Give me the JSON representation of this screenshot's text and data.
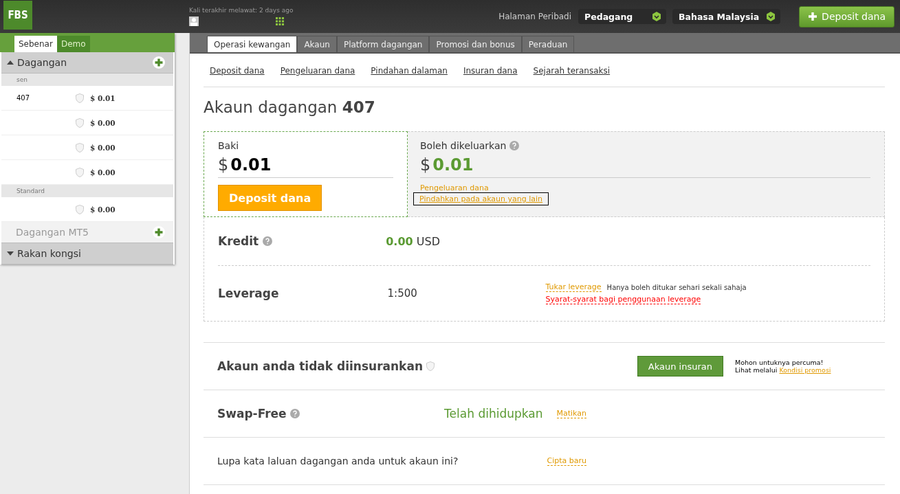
{
  "header": {
    "logo": "FBS",
    "last_visit": "Kali terakhir melawat: 2 days ago",
    "personal_label": "Halaman Peribadi",
    "role_select": "Pedagang",
    "language_select": "Bahasa Malaysia",
    "deposit_button": "Deposit dana"
  },
  "sidebar": {
    "tabs": [
      {
        "label": "Sebenar",
        "selected": true
      },
      {
        "label": "Demo",
        "selected": false
      }
    ],
    "sections": [
      {
        "title": "Dagangan",
        "expanded": true,
        "disabled": false,
        "add": true,
        "groups": [
          {
            "label": "sen",
            "accounts": [
              {
                "number": "407",
                "balance": "0.01",
                "currency": "$"
              },
              {
                "balance": "0.00",
                "currency": "$"
              },
              {
                "balance": "0.00",
                "currency": "$"
              },
              {
                "balance": "0.00",
                "currency": "$"
              }
            ]
          },
          {
            "label": "Standard",
            "accounts": [
              {
                "balance": "0.00",
                "currency": "$"
              }
            ]
          }
        ]
      },
      {
        "title": "Dagangan MT5",
        "expanded": false,
        "disabled": true,
        "add": true
      },
      {
        "title": "Rakan kongsi",
        "expanded": false,
        "disabled": false,
        "add": false
      }
    ]
  },
  "tabs": [
    {
      "label": "Operasi kewangan",
      "selected": true
    },
    {
      "label": "Akaun",
      "selected": false
    },
    {
      "label": "Platform dagangan",
      "selected": false
    },
    {
      "label": "Promosi dan bonus",
      "selected": false
    },
    {
      "label": "Peraduan",
      "selected": false
    }
  ],
  "sub_links": [
    "Deposit dana",
    "Pengeluaran dana",
    "Pindahan dalaman",
    "Insuran dana",
    "Sejarah teransaksi"
  ],
  "title": {
    "label": "Akaun dagangan",
    "number": "407"
  },
  "balance": {
    "label": "Baki",
    "currency": "$",
    "amount": "0.01",
    "button": "Deposit dana"
  },
  "withdrawable": {
    "label": "Boleh dikeluarkan",
    "currency": "$",
    "amount": "0.01",
    "links": [
      {
        "label": "Pengeluaran dana",
        "outlined": false
      },
      {
        "label": "Pindahkan pada akaun yang lain",
        "outlined": true
      }
    ]
  },
  "credit": {
    "label": "Kredit",
    "amount": "0.00",
    "unit": "USD"
  },
  "leverage": {
    "label": "Leverage",
    "value": "1:500",
    "change_link": "Tukar leverage",
    "note": "Hanya boleh ditukar sehari sekali sahaja",
    "terms_link": "Syarat-syarat bagi penggunaan leverage"
  },
  "insurance": {
    "label": "Akaun anda tidak diinsurankan",
    "button": "Akaun insuran",
    "note": "Mohon untuknya percuma!",
    "note2": "Lihat melalui",
    "promo_link": "Kondisi promosi"
  },
  "swap": {
    "label": "Swap-Free",
    "status": "Telah dihidupkan",
    "enabled": true,
    "link": "Matikan"
  },
  "password": {
    "label": "Lupa kata laluan dagangan anda untuk akaun ini?",
    "link": "Cipta baru"
  }
}
